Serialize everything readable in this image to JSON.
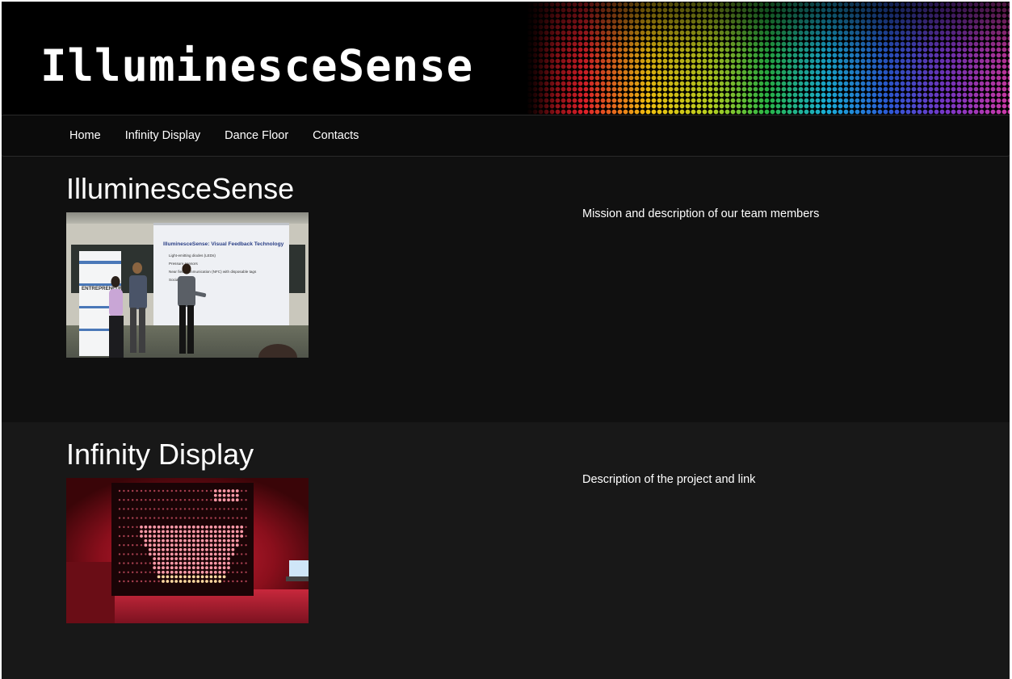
{
  "header": {
    "logo_text": "IlluminesceSense"
  },
  "nav": {
    "items": [
      {
        "label": "Home"
      },
      {
        "label": "Infinity Display"
      },
      {
        "label": "Dance Floor"
      },
      {
        "label": "Contacts"
      }
    ]
  },
  "sections": [
    {
      "title": "IlluminesceSense",
      "description": "Mission and description of our team members",
      "photo": {
        "slide_title": "IlluminesceSense: Visual Feedback Technology",
        "slide_bullets": [
          "Light-emitting diodes (LEDs)",
          "Pressure sensors",
          "Near field communication (NFC) with disposable tags",
          "Social"
        ],
        "banner_text": "ENTREPRENEUR"
      }
    },
    {
      "title": "Infinity Display",
      "description": "Description of the project and link"
    }
  ],
  "colors": {
    "page_background": "#181818",
    "section_alt_background": "#101010",
    "nav_background": "#0b0b0b",
    "text": "#ffffff"
  }
}
